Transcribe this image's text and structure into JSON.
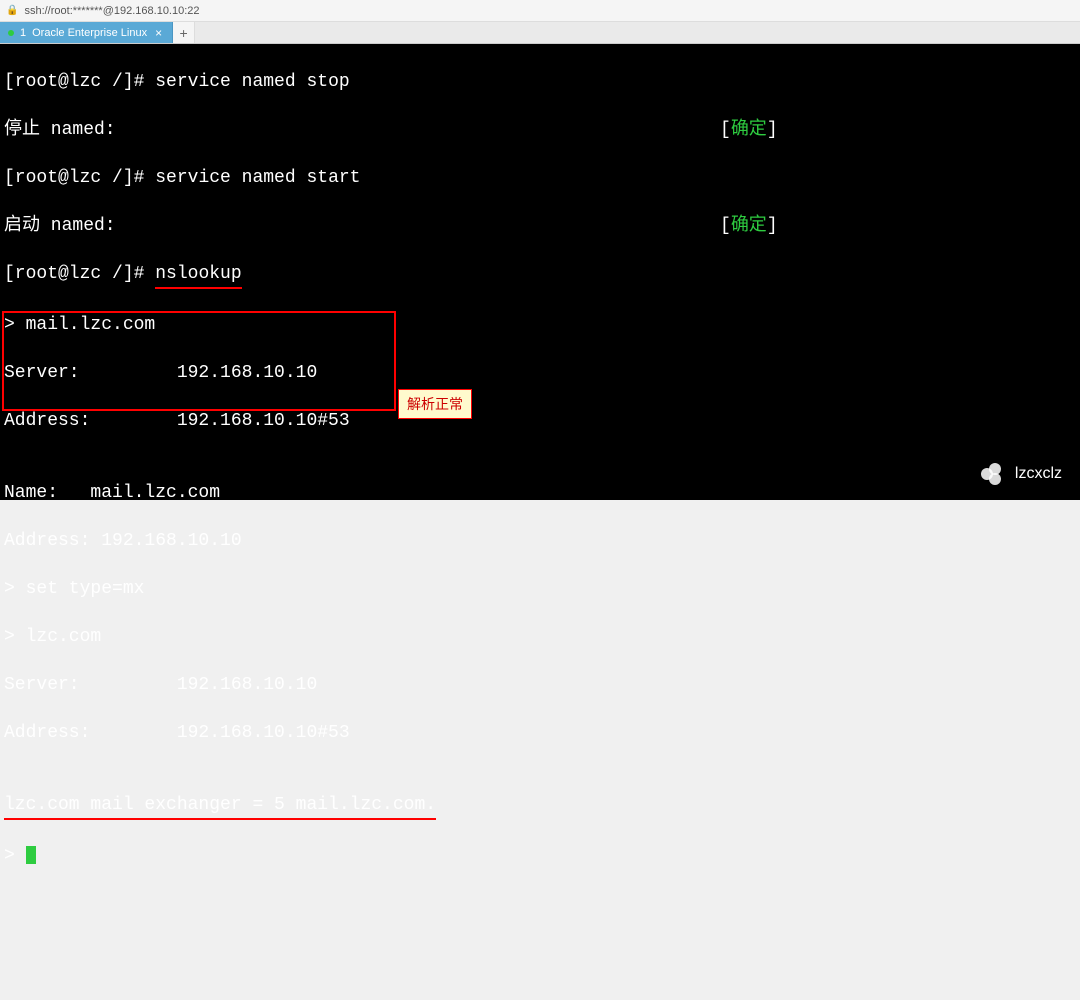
{
  "address_bar": {
    "url": "ssh://root:*******@192.168.10.10:22"
  },
  "tab": {
    "index": "1",
    "title": "Oracle Enterprise Linux",
    "close": "×"
  },
  "new_tab": "+",
  "terminal": {
    "l1_prompt": "[root@lzc /]# ",
    "l1_cmd": "service named stop",
    "l2_text": "停止 named:",
    "l2_status_l": "[",
    "l2_status": "确定",
    "l2_status_r": "]",
    "l3_prompt": "[root@lzc /]# ",
    "l3_cmd": "service named start",
    "l4_text": "启动 named:",
    "l4_status_l": "[",
    "l4_status": "确定",
    "l4_status_r": "]",
    "l5_prompt": "[root@lzc /]# ",
    "l5_cmd": "nslookup",
    "l6": "> mail.lzc.com",
    "l7": "Server:         192.168.10.10",
    "l8": "Address:        192.168.10.10#53",
    "l9": "",
    "l10": "Name:   mail.lzc.com",
    "l11": "Address: 192.168.10.10",
    "l12": "> set type=mx",
    "l13": "> lzc.com",
    "l14": "Server:         192.168.10.10",
    "l15": "Address:        192.168.10.10#53",
    "l16": "",
    "l17": "lzc.com mail exchanger = 5 mail.lzc.com.",
    "l18": "> "
  },
  "annotation": "解析正常",
  "watermark": "lzcxclz"
}
